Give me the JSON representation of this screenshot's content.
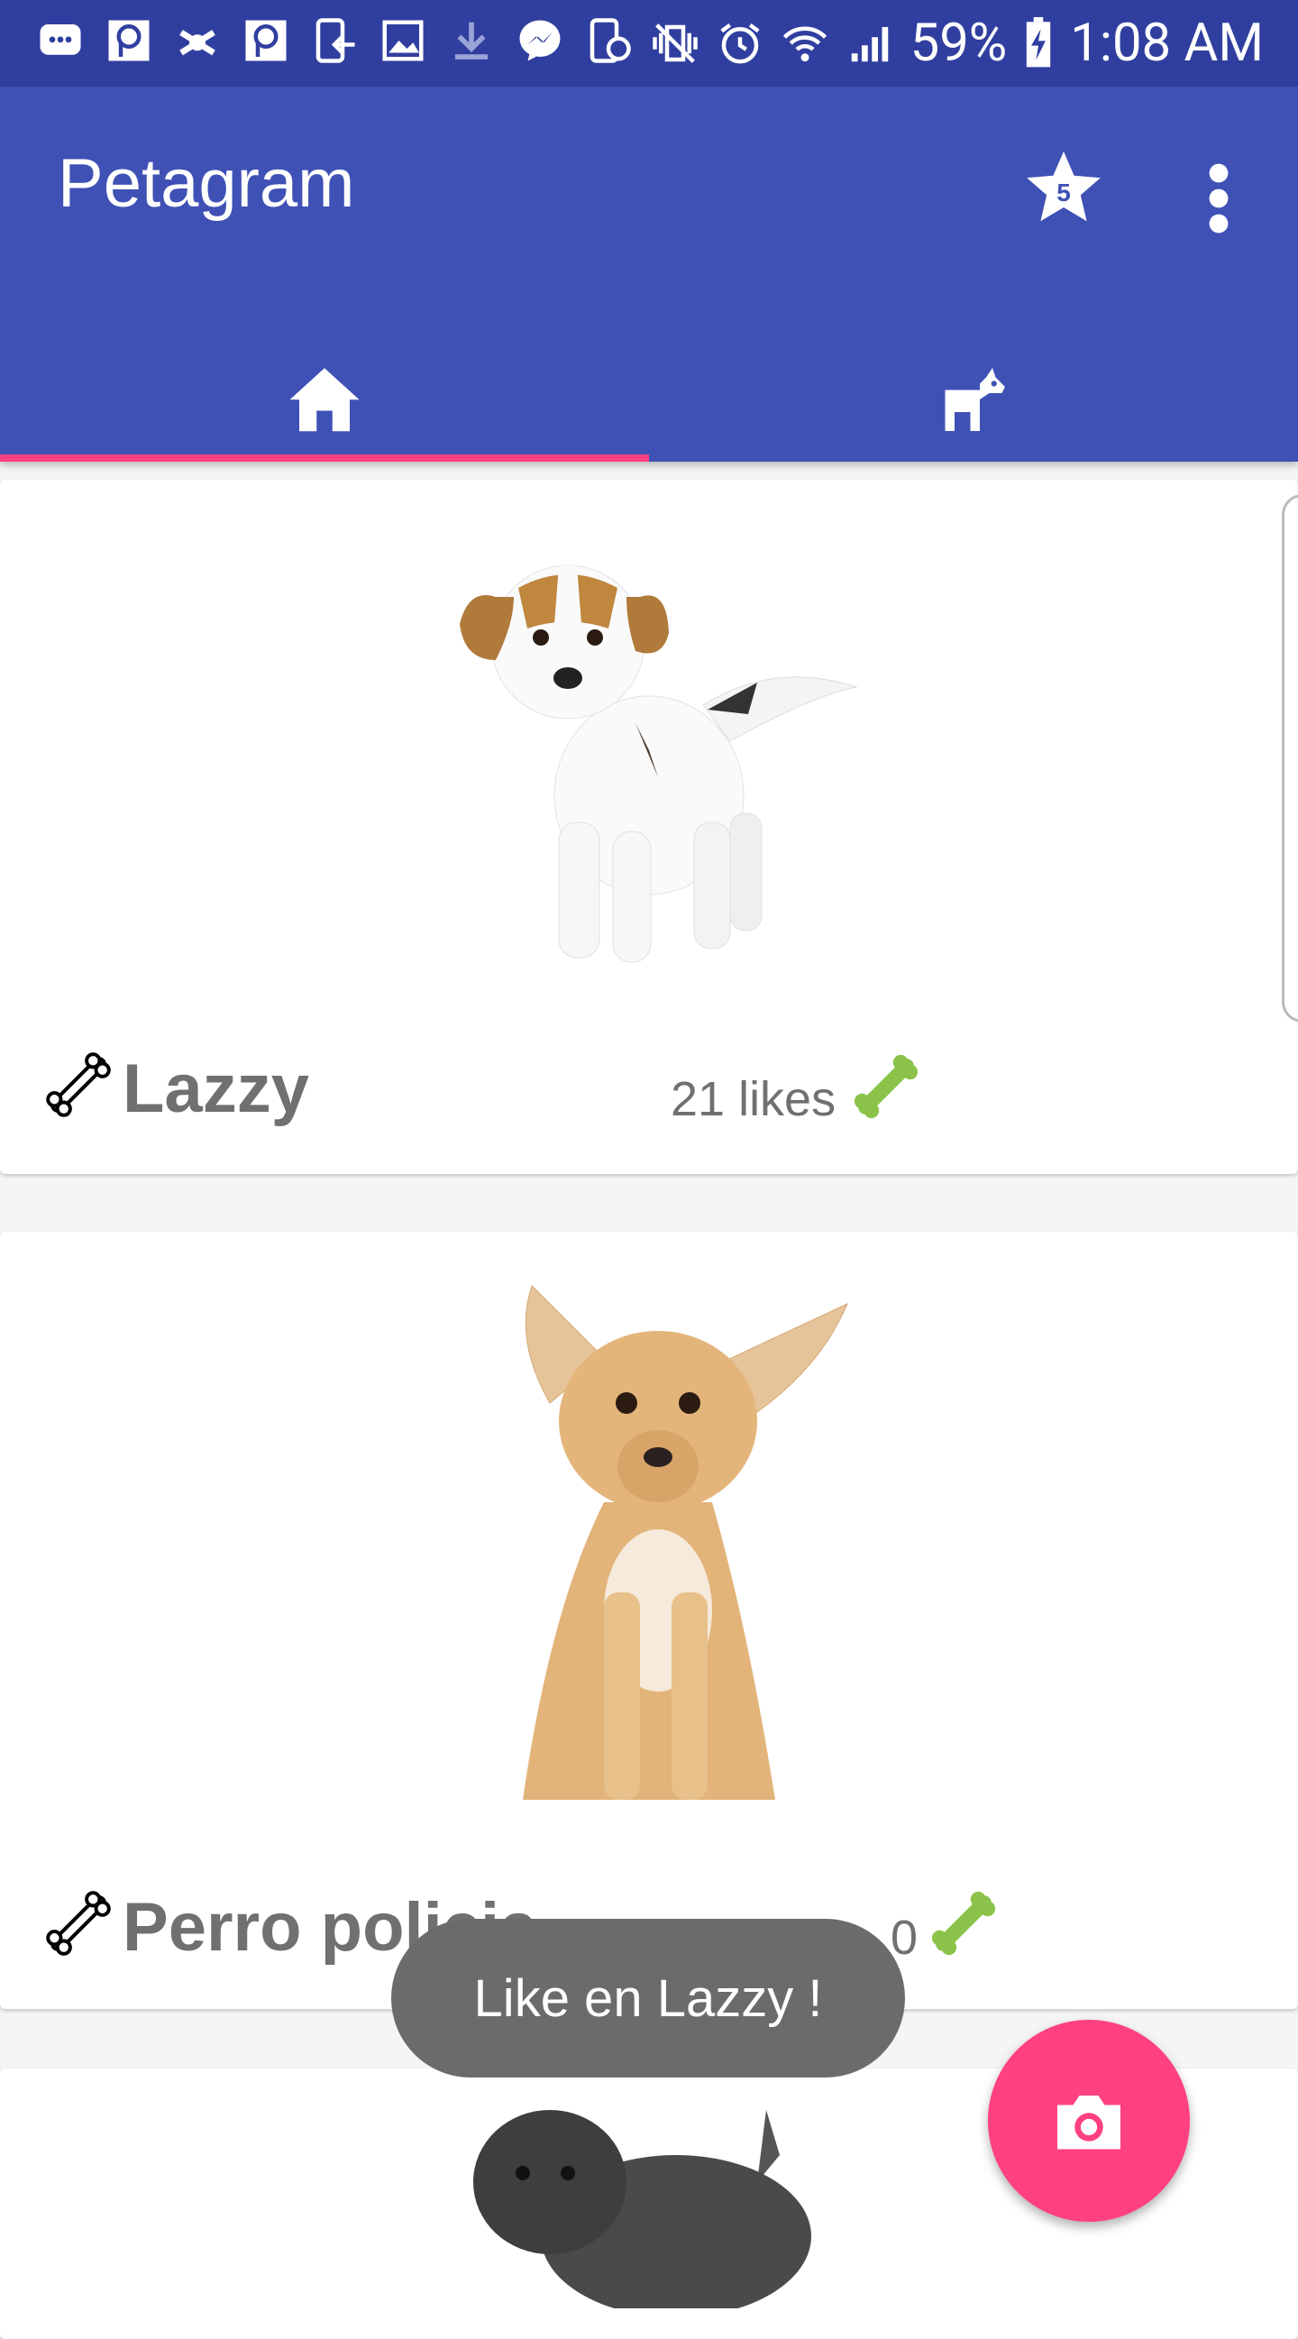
{
  "status_bar": {
    "battery": "59%",
    "time": "1:08 AM"
  },
  "app_bar": {
    "title": "Petagram",
    "star_badge": "5"
  },
  "tabs": [
    {
      "name": "home",
      "icon": "home-icon",
      "selected": true
    },
    {
      "name": "dog",
      "icon": "dog-icon",
      "selected": false
    }
  ],
  "pets": [
    {
      "name": "Lazzy",
      "likes": "21 likes"
    },
    {
      "name": "Perro policia",
      "likes": "0"
    },
    {
      "name": "",
      "likes": ""
    }
  ],
  "toast": {
    "text": "Like en Lazzy !"
  },
  "fab": {
    "icon": "camera-icon"
  },
  "colors": {
    "primary": "#3f51b5",
    "primary_dark": "#303f9f",
    "accent": "#ff4081",
    "like_bone": "#8bc34a"
  }
}
